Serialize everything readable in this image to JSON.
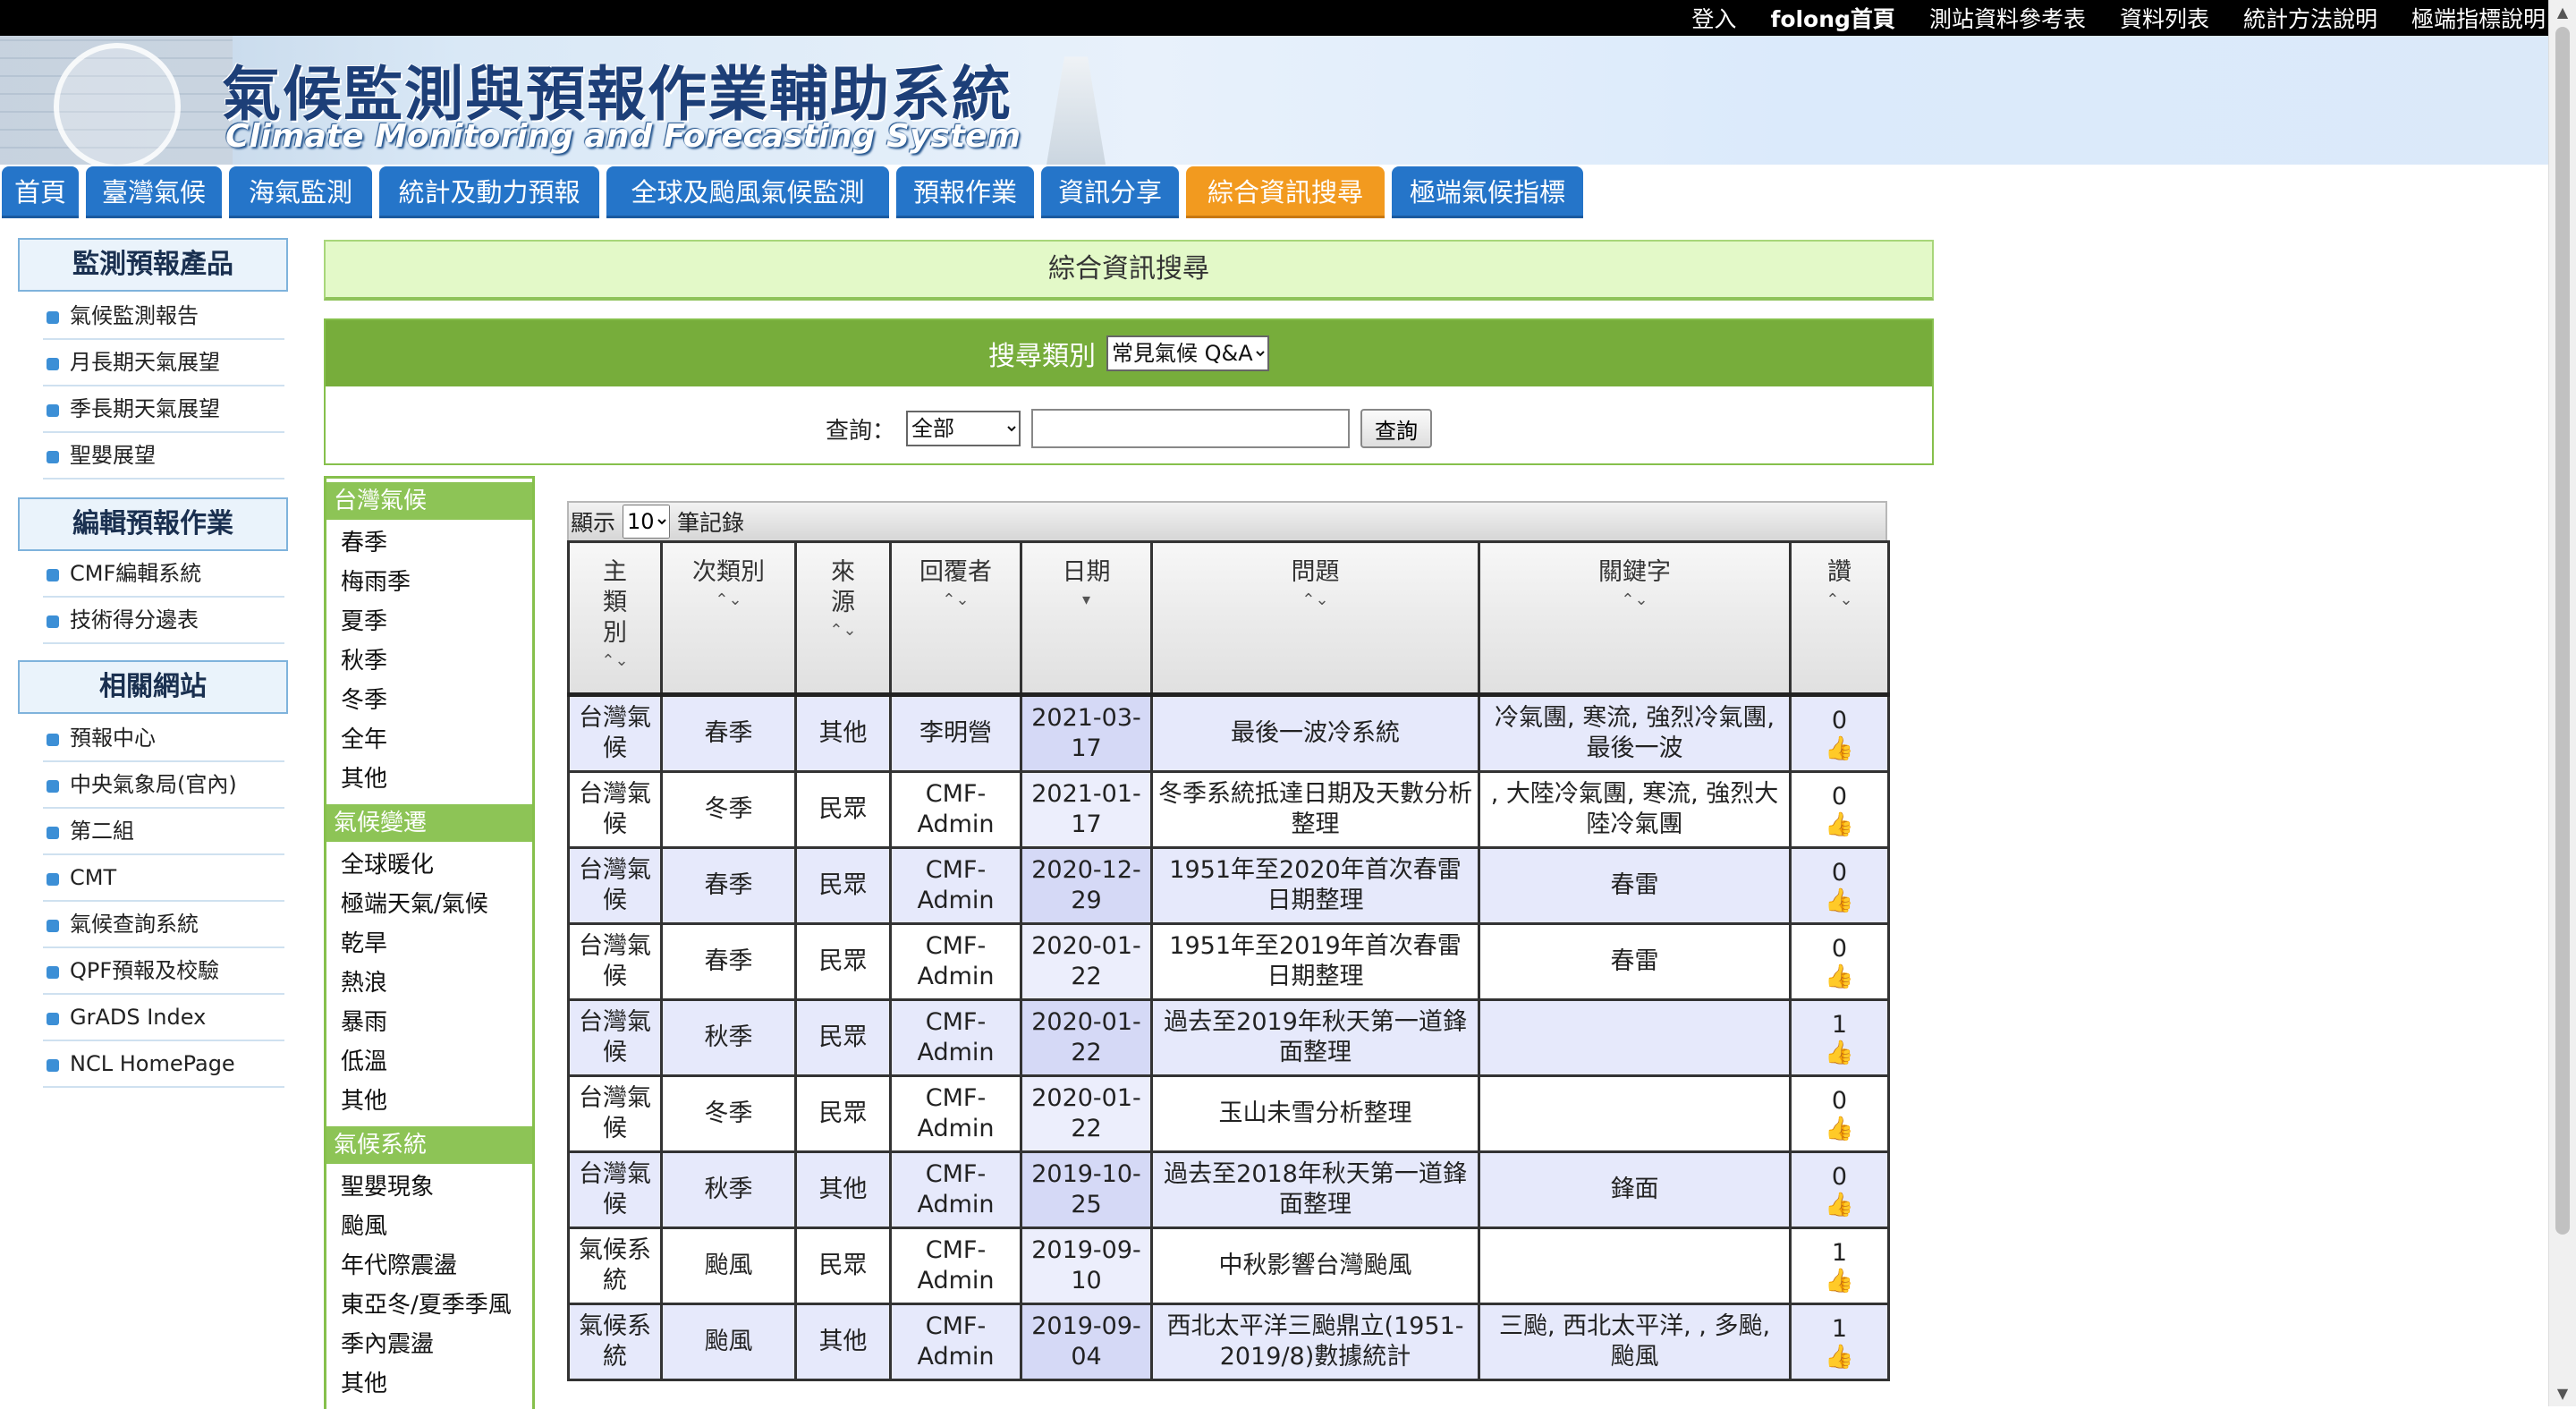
{
  "toplinks": [
    "登入",
    "folong首頁",
    "測站資料參考表",
    "資料列表",
    "統計方法說明",
    "極端指標說明"
  ],
  "banner": {
    "title": "氣候監測與預報作業輔助系統",
    "subtitle": "Climate Monitoring and Forecasting System"
  },
  "nav": [
    "首頁",
    "臺灣氣候",
    "海氣監測",
    "統計及動力預報",
    "全球及颱風氣候監測",
    "預報作業",
    "資訊分享",
    "綜合資訊搜尋",
    "極端氣候指標"
  ],
  "nav_active": "綜合資訊搜尋",
  "sidebar": {
    "sections": [
      {
        "title": "監測預報產品",
        "items": [
          "氣候監測報告",
          "月長期天氣展望",
          "季長期天氣展望",
          "聖嬰展望"
        ]
      },
      {
        "title": "編輯預報作業",
        "items": [
          "CMF編輯系統",
          "技術得分邊表"
        ]
      },
      {
        "title": "相關網站",
        "items": [
          "預報中心",
          "中央氣象局(官內)",
          "第二組",
          "CMT",
          "氣候查詢系統",
          "QPF預報及校驗",
          "GrADS Index",
          "NCL HomePage"
        ]
      }
    ]
  },
  "main": {
    "title": "綜合資訊搜尋",
    "search_category_label": "搜尋類別",
    "search_category_value": "常見氣候 Q&A",
    "query_label": "查詢：",
    "query_scope": "全部",
    "query_value": "",
    "query_button": "查詢"
  },
  "categories": [
    {
      "title": "台灣氣候",
      "items": [
        "春季",
        "梅雨季",
        "夏季",
        "秋季",
        "冬季",
        "全年",
        "其他"
      ]
    },
    {
      "title": "氣候變遷",
      "items": [
        "全球暖化",
        "極端天氣/氣候",
        "乾旱",
        "熱浪",
        "暴雨",
        "低溫",
        "其他"
      ]
    },
    {
      "title": "氣候系統",
      "items": [
        "聖嬰現象",
        "颱風",
        "年代際震盪",
        "東亞冬/夏季季風",
        "季內震盪",
        "其他"
      ]
    }
  ],
  "table": {
    "show_label": "顯示",
    "page_size": "10",
    "records_label": "筆記錄",
    "columns": [
      "主類別",
      "次類別",
      "來源",
      "回覆者",
      "日期",
      "問題",
      "關鍵字",
      "讚"
    ],
    "rows": [
      [
        "台灣氣候",
        "春季",
        "其他",
        "李明營",
        "2021-03-17",
        "最後一波冷系統",
        "冷氣團, 寒流, 強烈冷氣團, 最後一波",
        "0"
      ],
      [
        "台灣氣候",
        "冬季",
        "民眾",
        "CMF-Admin",
        "2021-01-17",
        "冬季系統抵達日期及天數分析整理",
        ", 大陸冷氣團, 寒流, 強烈大陸冷氣團",
        "0"
      ],
      [
        "台灣氣候",
        "春季",
        "民眾",
        "CMF-Admin",
        "2020-12-29",
        "1951年至2020年首次春雷日期整理",
        "春雷",
        "0"
      ],
      [
        "台灣氣候",
        "春季",
        "民眾",
        "CMF-Admin",
        "2020-01-22",
        "1951年至2019年首次春雷日期整理",
        "春雷",
        "0"
      ],
      [
        "台灣氣候",
        "秋季",
        "民眾",
        "CMF-Admin",
        "2020-01-22",
        "過去至2019年秋天第一道鋒面整理",
        "",
        "1"
      ],
      [
        "台灣氣候",
        "冬季",
        "民眾",
        "CMF-Admin",
        "2020-01-22",
        "玉山未雪分析整理",
        "",
        "0"
      ],
      [
        "台灣氣候",
        "秋季",
        "其他",
        "CMF-Admin",
        "2019-10-25",
        "過去至2018年秋天第一道鋒面整理",
        "鋒面",
        "0"
      ],
      [
        "氣候系統",
        "颱風",
        "民眾",
        "CMF-Admin",
        "2019-09-10",
        "中秋影響台灣颱風",
        "",
        "1"
      ],
      [
        "氣候系統",
        "颱風",
        "其他",
        "CMF-Admin",
        "2019-09-04",
        "西北太平洋三颱鼎立(1951-2019/8)數據統計",
        "三颱, 西北太平洋, , 多颱, 颱風",
        "1"
      ]
    ]
  },
  "icons": {
    "like": "thumbs-up-icon",
    "sort": "sort-arrows-icon"
  },
  "colors": {
    "nav": "#2575c9",
    "nav_active": "#f29a1f",
    "green": "#77ad3b"
  }
}
